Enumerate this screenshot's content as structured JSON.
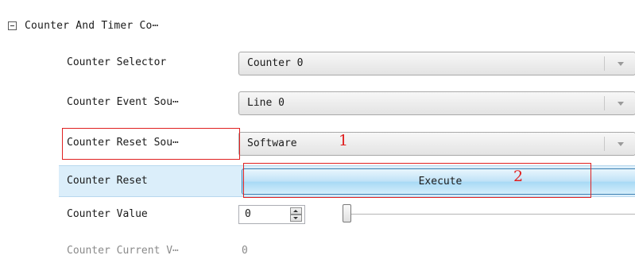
{
  "group": {
    "title": "Counter And Timer Co⋯"
  },
  "rows": {
    "counter_selector": {
      "label": "Counter Selector",
      "value": "Counter 0"
    },
    "counter_event_source": {
      "label": "Counter Event Sou⋯",
      "value": "Line 0"
    },
    "counter_reset_source": {
      "label": "Counter Reset Sou⋯",
      "value": "Software"
    },
    "counter_reset": {
      "label": "Counter Reset",
      "button": "Execute"
    },
    "counter_value": {
      "label": "Counter Value",
      "value": "0",
      "slider_position": 0
    },
    "counter_current_value": {
      "label": "Counter Current V⋯",
      "value": "0"
    }
  },
  "annotations": {
    "marker_1": "1",
    "marker_2": "2"
  },
  "colors": {
    "annotation_red": "#e02020",
    "selected_row": "#dbeefa",
    "button_blue": "#a7d9f5"
  }
}
